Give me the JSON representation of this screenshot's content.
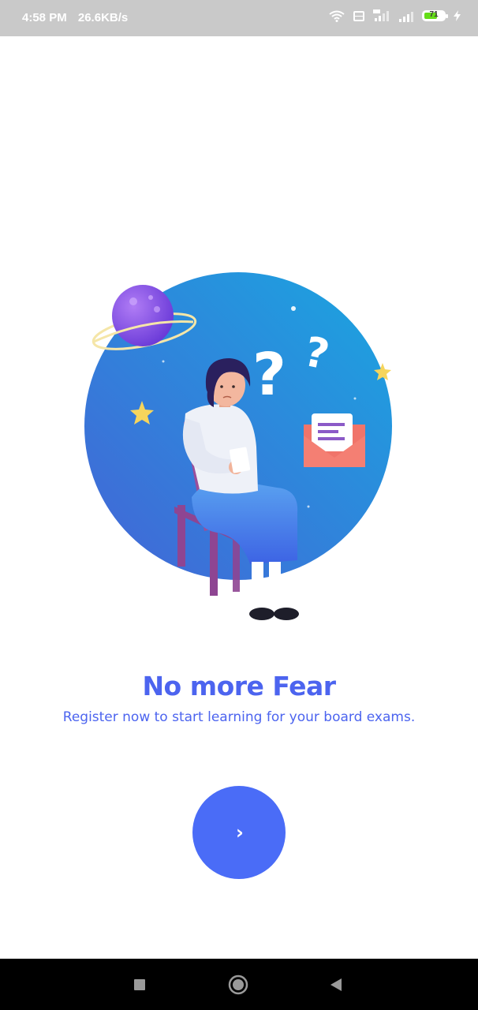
{
  "status_bar": {
    "time": "4:58 PM",
    "network_speed": "26.6KB/s",
    "battery_level": "71",
    "battery_fraction": 0.71,
    "icons": [
      "wifi-icon",
      "volte-icon",
      "signal-4g-icon",
      "signal-icon",
      "battery-icon",
      "charging-icon"
    ]
  },
  "onboarding": {
    "title": "No more Fear",
    "subtitle": "Register now to start learning for your board exams.",
    "next_icon": "chevron-right-icon",
    "next_symbol": "›",
    "illustration": "confused-student-illustration"
  },
  "nav_bar": {
    "icons": [
      "recent-apps-icon",
      "home-icon",
      "back-icon"
    ]
  },
  "colors": {
    "accent": "#4a6cf7",
    "title_text": "#4c64ef",
    "status_bar": "#c9c9c9",
    "nav_bar": "#000000"
  }
}
